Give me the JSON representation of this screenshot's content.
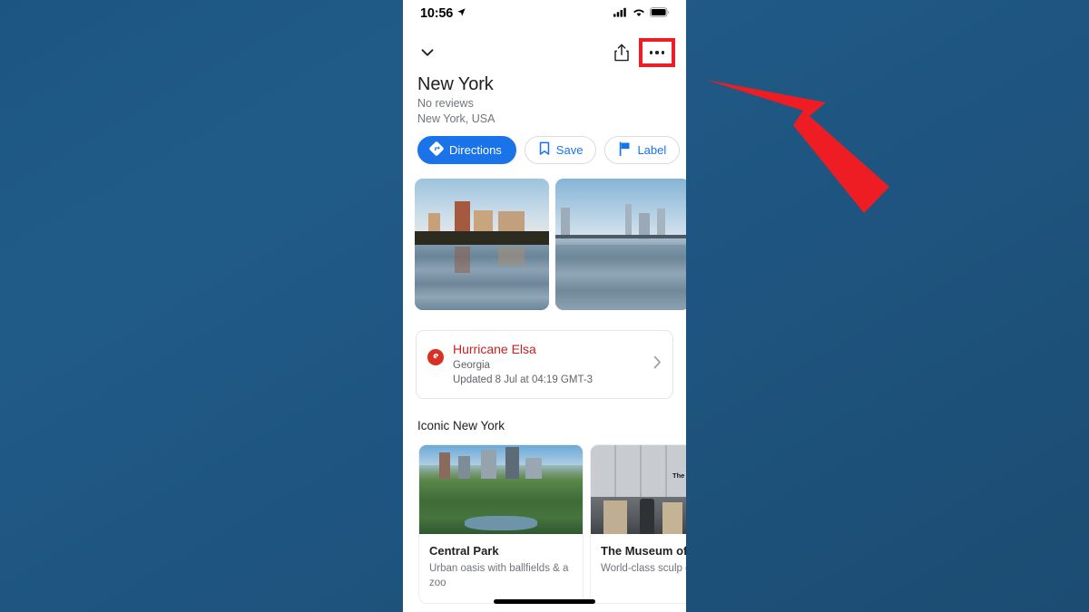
{
  "background": {
    "color_top": "#1d5582",
    "color_bottom": "#1c4c72"
  },
  "annotation": {
    "arrow_color": "#ee1d24",
    "arrow_direction": "up-left",
    "highlight_color": "#ee1d24",
    "highlight_target": "more-options-button"
  },
  "phone": {
    "status_bar": {
      "time": "10:56",
      "location_icon": "location-arrow-icon",
      "cellular_icon": "cellular-signal-icon",
      "wifi_icon": "wifi-icon",
      "battery_icon": "battery-full-icon"
    },
    "header": {
      "collapse_icon": "chevron-down-icon",
      "share_icon": "share-icon",
      "more_icon": "more-options-icon"
    },
    "place": {
      "title": "New York",
      "reviews": "No reviews",
      "location": "New York, USA"
    },
    "actions": [
      {
        "label": "Directions",
        "icon": "directions-icon",
        "primary": true
      },
      {
        "label": "Save",
        "icon": "bookmark-icon",
        "primary": false
      },
      {
        "label": "Label",
        "icon": "flag-icon",
        "primary": false
      },
      {
        "label": "",
        "icon": "share-icon",
        "primary": false
      }
    ],
    "photos": [
      {
        "name": "central-park-reservoir-photo"
      },
      {
        "name": "brooklyn-bridge-photo"
      }
    ],
    "alert": {
      "icon": "hurricane-icon",
      "title": "Hurricane Elsa",
      "region": "Georgia",
      "updated": "Updated 8 Jul at 04:19 GMT-3",
      "chevron": "chevron-right-icon",
      "title_color": "#c5221f"
    },
    "iconic_section": {
      "title": "Iconic New York",
      "cards": [
        {
          "name": "Central Park",
          "description": "Urban oasis with ballfields & a zoo",
          "image": "central-park-photo"
        },
        {
          "name": "The Museum of Art",
          "description": "World-class sculp design",
          "image": "museum-of-modern-art-photo",
          "image_sign": "The Museum o' Mo"
        }
      ]
    },
    "home_indicator": "home-indicator-bar"
  }
}
